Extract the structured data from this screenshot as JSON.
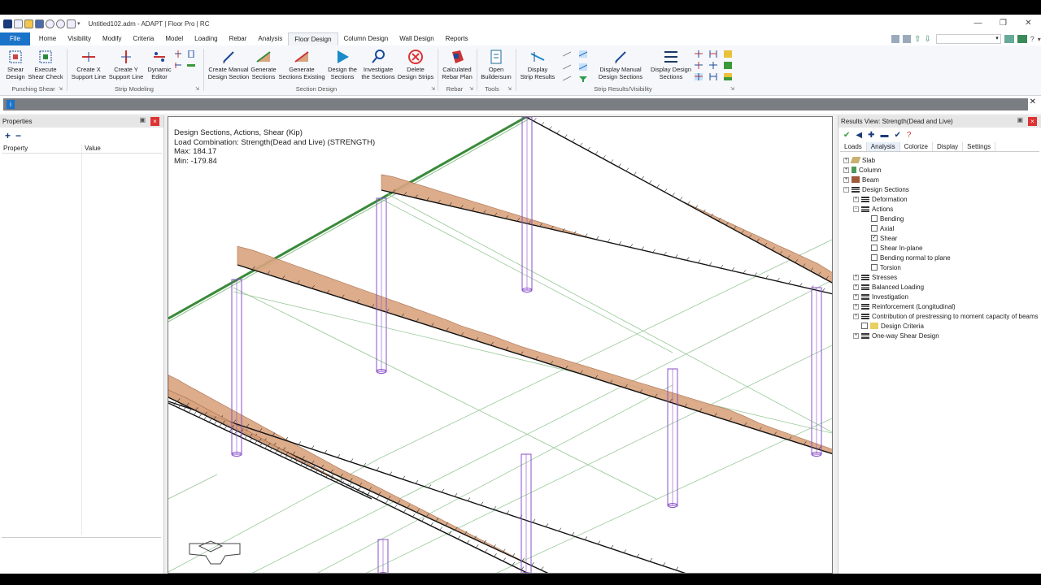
{
  "app": {
    "title": "Untitled102.adm - ADAPT | Floor Pro | RC"
  },
  "window_controls": [
    "—",
    "❐",
    "✕"
  ],
  "menu": {
    "tabs": [
      "File",
      "Home",
      "Visibility",
      "Modify",
      "Criteria",
      "Model",
      "Loading",
      "Rebar",
      "Analysis",
      "Floor Design",
      "Column Design",
      "Wall Design",
      "Reports"
    ],
    "active": "Floor Design"
  },
  "ribbon": {
    "buttons": [
      {
        "line1": "Shear",
        "line2": "Design"
      },
      {
        "line1": "Execute",
        "line2": "Shear Check"
      },
      {
        "line1": "Create X",
        "line2": "Support Line"
      },
      {
        "line1": "Create Y",
        "line2": "Support Line"
      },
      {
        "line1": "Dynamic",
        "line2": "Editor"
      },
      {
        "line1": "Create Manual",
        "line2": "Design Section"
      },
      {
        "line1": "Generate",
        "line2": "Sections"
      },
      {
        "line1": "Generate",
        "line2": "Sections Existing"
      },
      {
        "line1": "Design the",
        "line2": "Sections"
      },
      {
        "line1": "Investigate",
        "line2": "the Sections"
      },
      {
        "line1": "Delete",
        "line2": "Design Strips"
      },
      {
        "line1": "Calculated",
        "line2": "Rebar Plan"
      },
      {
        "line1": "Open",
        "line2": "Buildersum"
      },
      {
        "line1": "Display",
        "line2": "Strip Results"
      },
      {
        "line1": "Display Manual",
        "line2": "Design Sections"
      },
      {
        "line1": "Display Design",
        "line2": "Sections"
      }
    ],
    "groups": [
      "Punching Shear",
      "Strip Modeling",
      "Section Design",
      "Rebar",
      "Tools",
      "Strip Results/Visibility"
    ]
  },
  "info": {
    "icon": "i",
    "close": "✕"
  },
  "properties": {
    "title": "Properties",
    "col_property": "Property",
    "col_value": "Value",
    "add": "+",
    "remove": "−"
  },
  "viewport": {
    "line1": "Design Sections, Actions, Shear (Kip)",
    "line2": "Load Combination: Strength(Dead and Live) (STRENGTH)",
    "line3": "Max: 184.17",
    "line4": "Min: -179.84"
  },
  "results": {
    "title": "Results View: Strength(Dead and Live)",
    "tabs": [
      "Loads",
      "Analysis",
      "Colorize",
      "Display",
      "Settings"
    ],
    "active_tab": "Analysis",
    "tree": [
      {
        "label": "Slab",
        "level": 0,
        "exp": "+",
        "icon": "slab-icon"
      },
      {
        "label": "Column",
        "level": 0,
        "exp": "+",
        "icon": "column-icon"
      },
      {
        "label": "Beam",
        "level": 0,
        "exp": "+",
        "icon": "beam-icon"
      },
      {
        "label": "Design Sections",
        "level": 0,
        "exp": "−",
        "icon": "grid-icon"
      },
      {
        "label": "Deformation",
        "level": 1,
        "exp": "+",
        "icon": "grid-icon"
      },
      {
        "label": "Actions",
        "level": 1,
        "exp": "−",
        "icon": "grid-icon"
      },
      {
        "label": "Bending",
        "level": 2,
        "check": false
      },
      {
        "label": "Axial",
        "level": 2,
        "check": false
      },
      {
        "label": "Shear",
        "level": 2,
        "check": true
      },
      {
        "label": "Shear In-plane",
        "level": 2,
        "check": false
      },
      {
        "label": "Bending normal to plane",
        "level": 2,
        "check": false
      },
      {
        "label": "Torsion",
        "level": 2,
        "check": false
      },
      {
        "label": "Stresses",
        "level": 1,
        "exp": "+",
        "icon": "grid-icon"
      },
      {
        "label": "Balanced Loading",
        "level": 1,
        "exp": "+",
        "icon": "grid-icon"
      },
      {
        "label": "Investigation",
        "level": 1,
        "exp": "+",
        "icon": "grid-icon"
      },
      {
        "label": "Reinforcement (Longitudinal)",
        "level": 1,
        "exp": "+",
        "icon": "grid-icon"
      },
      {
        "label": "Contribution of prestressing to moment capacity of beams",
        "level": 1,
        "exp": "+",
        "icon": "grid-icon"
      },
      {
        "label": "Design Criteria",
        "level": 1,
        "check": false,
        "icon": "criteria-icon"
      },
      {
        "label": "One-way Shear Design",
        "level": 1,
        "exp": "+",
        "icon": "grid-icon"
      }
    ]
  },
  "colors": {
    "accent": "#1a73c8",
    "shear_fill": "#d9a47f",
    "shear_stroke": "#a0603a",
    "column": "#8a4fc8",
    "beam": "#3a8a3a"
  }
}
